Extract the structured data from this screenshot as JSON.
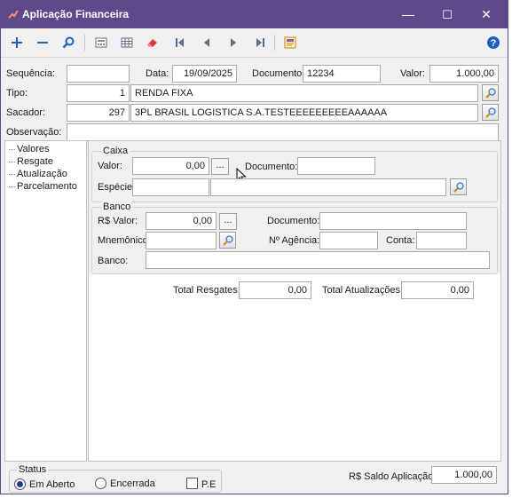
{
  "window": {
    "title": "Aplicação Financeira",
    "controls": {
      "minimize": "—",
      "maximize": "☐",
      "close": "✕"
    }
  },
  "toolbar": {
    "icons": [
      "add-icon",
      "remove-icon",
      "search-icon",
      "calculator-icon",
      "grid-icon",
      "eraser-icon",
      "first-icon",
      "previous-icon",
      "next-icon",
      "last-icon",
      "report-icon",
      "help-icon"
    ]
  },
  "header": {
    "sequencia_label": "Sequência:",
    "sequencia_value": "",
    "data_label": "Data:",
    "data_value": "19/09/2025",
    "documento_label": "Documento:",
    "documento_value": "12234",
    "valor_label": "Valor:",
    "valor_value": "1.000,00",
    "tipo_label": "Tipo:",
    "tipo_code": "1",
    "tipo_name": "RENDA FIXA",
    "sacador_label": "Sacador:",
    "sacador_code": "297",
    "sacador_name": "3PL BRASIL LOGISTICA S.A.TESTEEEEEEEEEAAAAAA",
    "observacao_label": "Observação:",
    "observacao_value": ""
  },
  "tree": {
    "items": [
      "Valores",
      "Resgate",
      "Atualização",
      "Parcelamento"
    ]
  },
  "caixa": {
    "title": "Caixa",
    "valor_label": "Valor:",
    "valor_value": "0,00",
    "dots": "...",
    "documento_label": "Documento:",
    "documento_value": "",
    "especie_label": "Espécie:",
    "especie_code": "",
    "especie_name": ""
  },
  "banco": {
    "title": "Banco",
    "valor_label": "R$ Valor:",
    "valor_value": "0,00",
    "dots": "...",
    "documento_label": "Documento:",
    "documento_value": "",
    "mnemonico_label": "Mnemônico:",
    "mnemonico_value": "",
    "agencia_label": "Nº Agência:",
    "agencia_value": "",
    "conta_label": "Conta:",
    "conta_value": "",
    "banco_label": "Banco:",
    "banco_value": ""
  },
  "totals": {
    "resgates_label": "Total Resgates:",
    "resgates_value": "0,00",
    "atualizacoes_label": "Total Atualizações:",
    "atualizacoes_value": "0,00"
  },
  "status": {
    "title": "Status",
    "em_aberto": "Em Aberto",
    "encerrada": "Encerrada",
    "pe": "P.E",
    "selected": "Em Aberto"
  },
  "saldo": {
    "label": "R$ Saldo Aplicação:",
    "value": "1.000,00"
  },
  "colors": {
    "titlebar": "#5e4a8b",
    "accent_blue": "#1f5fbf",
    "help": "#1f5fbf"
  }
}
